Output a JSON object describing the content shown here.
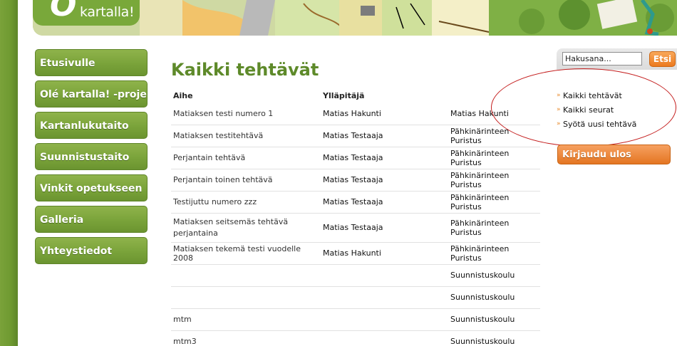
{
  "logo": {
    "text": "kartalla!"
  },
  "nav": {
    "items": [
      {
        "label": "Etusivulle"
      },
      {
        "label": "Olé kartalla! -projekti"
      },
      {
        "label": "Kartanlukutaito"
      },
      {
        "label": "Suunnistustaito"
      },
      {
        "label": "Vinkit opetukseen"
      },
      {
        "label": "Galleria"
      },
      {
        "label": "Yhteystiedot"
      }
    ]
  },
  "main": {
    "title": "Kaikki tehtävät",
    "columns": {
      "topic": "Aihe",
      "owner": "Ylläpitäjä",
      "org": ""
    },
    "rows": [
      {
        "topic": "Matiaksen testi numero 1",
        "owner": "Matias Hakunti",
        "org": "Matias Hakunti"
      },
      {
        "topic": "Matiaksen testitehtävä",
        "owner": "Matias Testaaja",
        "org": "Pähkinärinteen Puristus"
      },
      {
        "topic": "Perjantain tehtävä",
        "owner": "Matias Testaaja",
        "org": "Pähkinärinteen Puristus"
      },
      {
        "topic": "Perjantain toinen tehtävä",
        "owner": "Matias Testaaja",
        "org": "Pähkinärinteen Puristus"
      },
      {
        "topic": "Testijuttu numero zzz",
        "owner": "Matias Testaaja",
        "org": "Pähkinärinteen Puristus"
      },
      {
        "topic": "Matiaksen seitsemäs tehtävä perjantaina",
        "owner": "Matias Testaaja",
        "org": "Pähkinärinteen Puristus"
      },
      {
        "topic": "Matiaksen tekemä testi vuodelle 2008",
        "owner": "Matias Hakunti",
        "org": "Pähkinärinteen Puristus"
      },
      {
        "topic": "",
        "owner": "",
        "org": "Suunnistuskoulu"
      },
      {
        "topic": "",
        "owner": "",
        "org": "Suunnistuskoulu"
      },
      {
        "topic": "mtm",
        "owner": "",
        "org": "Suunnistuskoulu"
      },
      {
        "topic": "mtm3",
        "owner": "",
        "org": "Suunnistuskoulu"
      }
    ]
  },
  "search": {
    "value": "Hakusana...",
    "button_label": "Etsi"
  },
  "side_links": [
    {
      "label": "Kaikki tehtävät"
    },
    {
      "label": "Kaikki seurat"
    },
    {
      "label": "Syötä uusi tehtävä"
    }
  ],
  "logout": {
    "label": "Kirjaudu ulos"
  },
  "colors": {
    "brand_green": "#79a83a",
    "accent_orange": "#ec7a1e",
    "annotation_red": "#c41e1e"
  }
}
